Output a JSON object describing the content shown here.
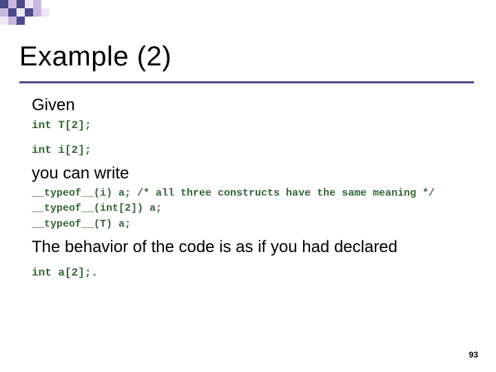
{
  "title": "Example (2)",
  "line_given": "Given",
  "code_decl1": "int T[2];",
  "code_decl2": "int i[2];",
  "line_youcan": "you can write",
  "code_typeof1": "__typeof__(i) a; /* all three constructs have the same meaning */",
  "code_typeof2": "__typeof__(int[2]) a;",
  "code_typeof3": "__typeof__(T) a;",
  "line_behavior": "The behavior of the code is as if you had declared",
  "code_result": "int a[2];.",
  "page_number": "93"
}
